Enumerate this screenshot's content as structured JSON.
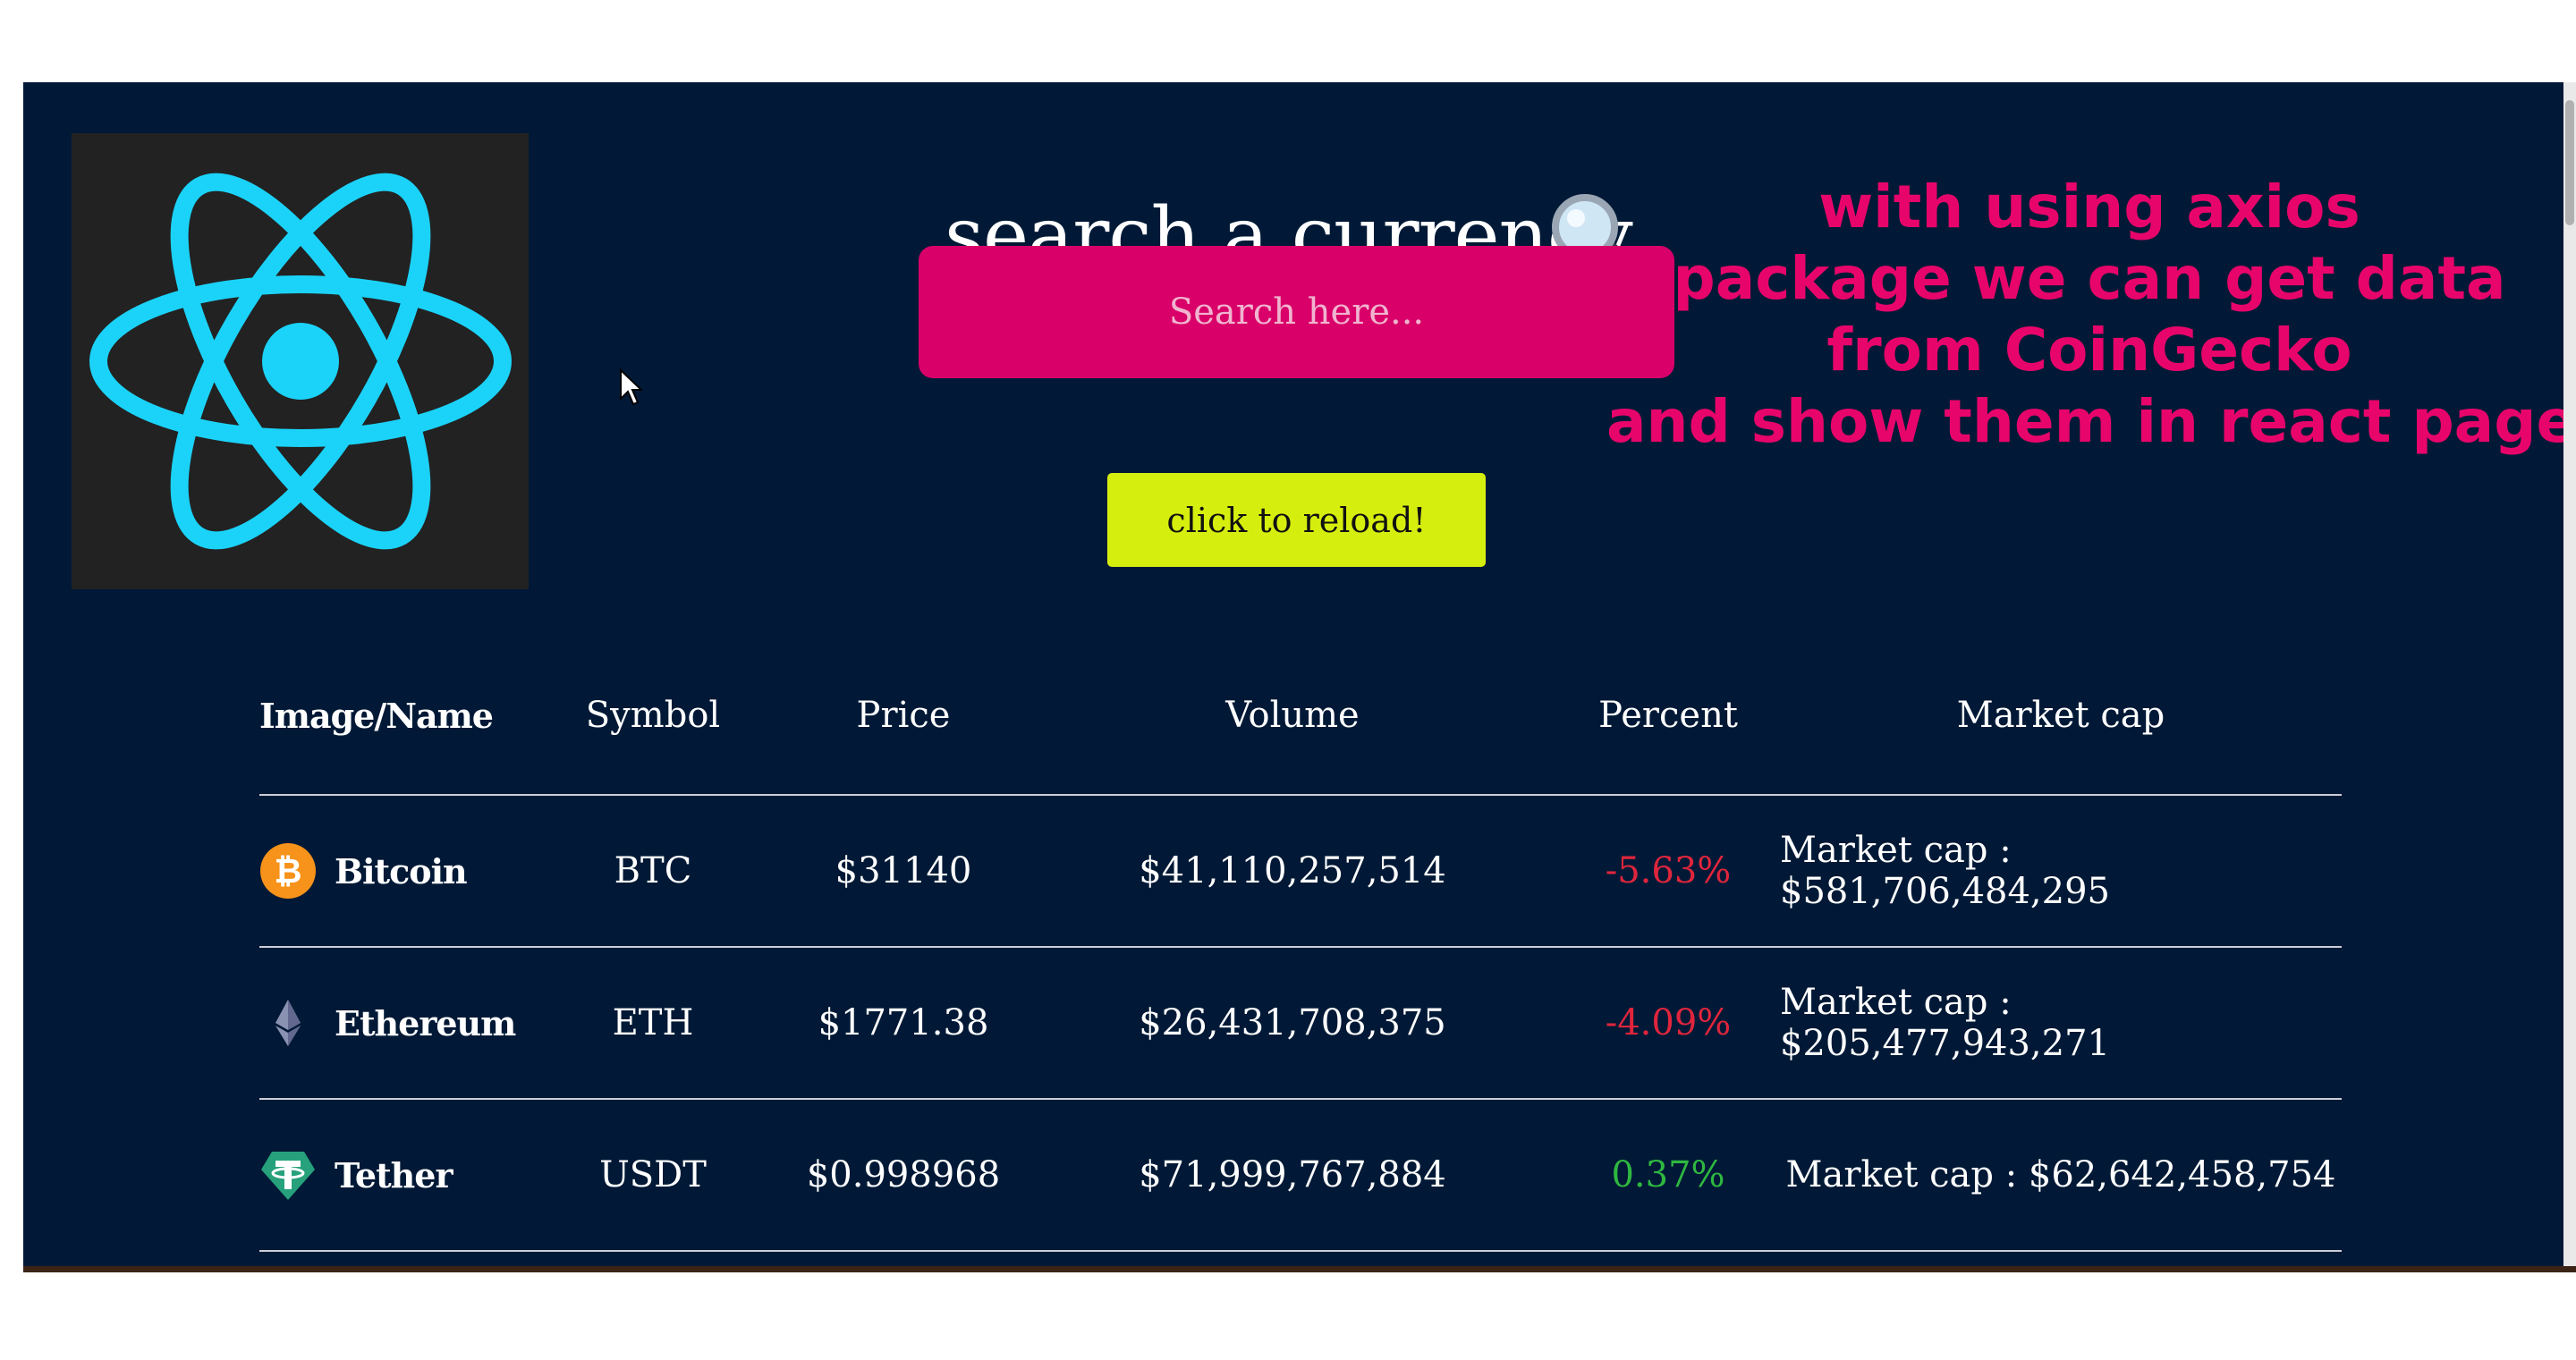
{
  "logo": {
    "icon": "react-icon",
    "colors": {
      "atom": "#1bd3f9",
      "background": "#222222"
    }
  },
  "search": {
    "title": "search a currency",
    "title_icon": "🔍",
    "placeholder": "Search here...",
    "value": ""
  },
  "reload_button": {
    "label": "click to reload!"
  },
  "caption": {
    "lines": [
      "with using axios",
      "package we can get data",
      "from CoinGecko",
      "and show them in react page"
    ],
    "color": "#e8056b"
  },
  "table": {
    "headers": {
      "name": "Image/Name",
      "symbol": "Symbol",
      "price": "Price",
      "volume": "Volume",
      "percent": "Percent",
      "market_cap": "Market cap"
    },
    "rows": [
      {
        "icon": "bitcoin-icon",
        "name": "Bitcoin",
        "symbol": "BTC",
        "price": "$31140",
        "volume": "$41,110,257,514",
        "percent": "-5.63%",
        "trend": "neg",
        "market_cap": "Market cap : $581,706,484,295"
      },
      {
        "icon": "ethereum-icon",
        "name": "Ethereum",
        "symbol": "ETH",
        "price": "$1771.38",
        "volume": "$26,431,708,375",
        "percent": "-4.09%",
        "trend": "neg",
        "market_cap": "Market cap : $205,477,943,271"
      },
      {
        "icon": "tether-icon",
        "name": "Tether",
        "symbol": "USDT",
        "price": "$0.998968",
        "volume": "$71,999,767,884",
        "percent": "0.37%",
        "trend": "pos",
        "market_cap": "Market cap : $62,642,458,754"
      }
    ]
  },
  "colors": {
    "page_background": "#011936",
    "search_input": "#d90069",
    "reload_button": "#d6ee0e",
    "negative": "#e0253c",
    "positive": "#2fb841"
  }
}
